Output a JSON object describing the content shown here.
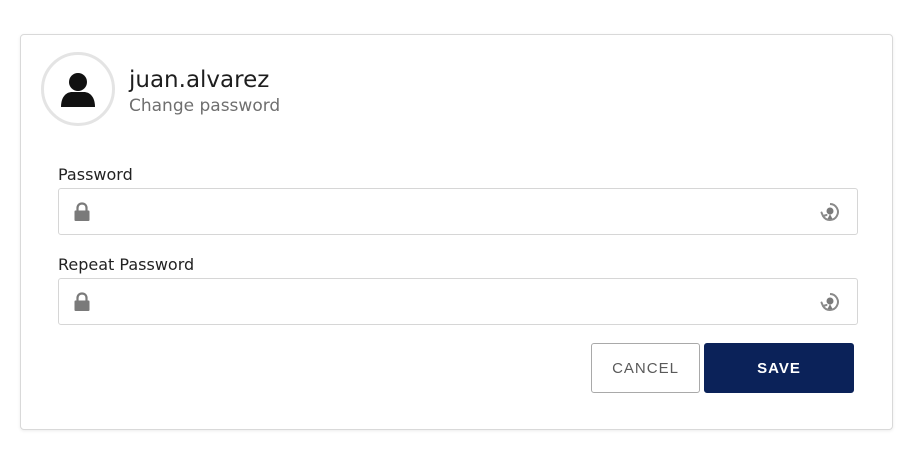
{
  "user": {
    "avatar_icon": "user-silhouette-icon",
    "username": "juan.alvarez",
    "subtitle": "Change password"
  },
  "form": {
    "password": {
      "label": "Password",
      "value": "",
      "leading_icon": "lock-icon",
      "trailing_icon": "eye-toggle-icon"
    },
    "repeat_password": {
      "label": "Repeat Password",
      "value": "",
      "leading_icon": "lock-icon",
      "trailing_icon": "eye-toggle-icon"
    }
  },
  "actions": {
    "cancel_label": "CANCEL",
    "save_label": "SAVE"
  },
  "colors": {
    "primary": "#0b2259",
    "border": "#d6d6d6",
    "icon": "#7a7a7a"
  }
}
